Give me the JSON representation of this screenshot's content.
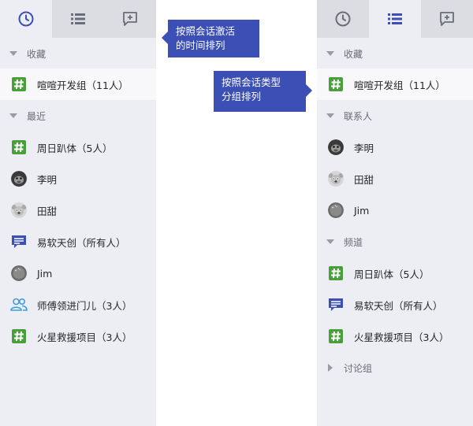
{
  "left": {
    "tabs": [
      {
        "icon": "clock-icon",
        "active": true
      },
      {
        "icon": "list-icon",
        "active": false
      },
      {
        "icon": "chat-add-icon",
        "active": false
      }
    ],
    "sections": [
      {
        "label": "收藏",
        "expanded": true
      },
      {
        "label": "最近",
        "expanded": true
      }
    ],
    "items": [
      {
        "label": "喧喧开发组（11人）",
        "icon": "hash-icon"
      },
      {
        "label": "周日趴体（5人）",
        "icon": "hash-icon"
      },
      {
        "label": "李明",
        "icon": "gorilla-avatar"
      },
      {
        "label": "田甜",
        "icon": "koala-avatar"
      },
      {
        "label": "易软天创（所有人）",
        "icon": "chat-bubble-icon"
      },
      {
        "label": "Jim",
        "icon": "flag-avatar"
      },
      {
        "label": "师傅领进门儿（3人）",
        "icon": "group-people-icon"
      },
      {
        "label": "火星救援项目（3人）",
        "icon": "hash-icon"
      }
    ]
  },
  "right": {
    "tabs": [
      {
        "icon": "clock-icon",
        "active": false
      },
      {
        "icon": "list-icon",
        "active": true
      },
      {
        "icon": "chat-add-icon",
        "active": false
      }
    ],
    "sections": [
      {
        "label": "收藏",
        "expanded": true
      },
      {
        "label": "联系人",
        "expanded": true
      },
      {
        "label": "频道",
        "expanded": true
      },
      {
        "label": "讨论组",
        "expanded": false
      }
    ],
    "items": [
      {
        "label": "喧喧开发组（11人）",
        "icon": "hash-icon"
      },
      {
        "label": "李明",
        "icon": "gorilla-avatar"
      },
      {
        "label": "田甜",
        "icon": "koala-avatar"
      },
      {
        "label": "Jim",
        "icon": "flag-avatar"
      },
      {
        "label": "周日趴体（5人）",
        "icon": "hash-icon"
      },
      {
        "label": "易软天创（所有人）",
        "icon": "chat-bubble-icon"
      },
      {
        "label": "火星救援项目（3人）",
        "icon": "hash-icon"
      }
    ]
  },
  "callouts": {
    "time_sort": {
      "line1": "按照会话激活",
      "line2": "的时间排列"
    },
    "type_sort": {
      "line1": "按照会话类型",
      "line2": "分组排列"
    }
  },
  "colors": {
    "accent": "#3b4fb5",
    "hash_green": "#4a9e3b",
    "panel_bg": "#eceef3",
    "tabbar_bg": "#dcdde3"
  }
}
